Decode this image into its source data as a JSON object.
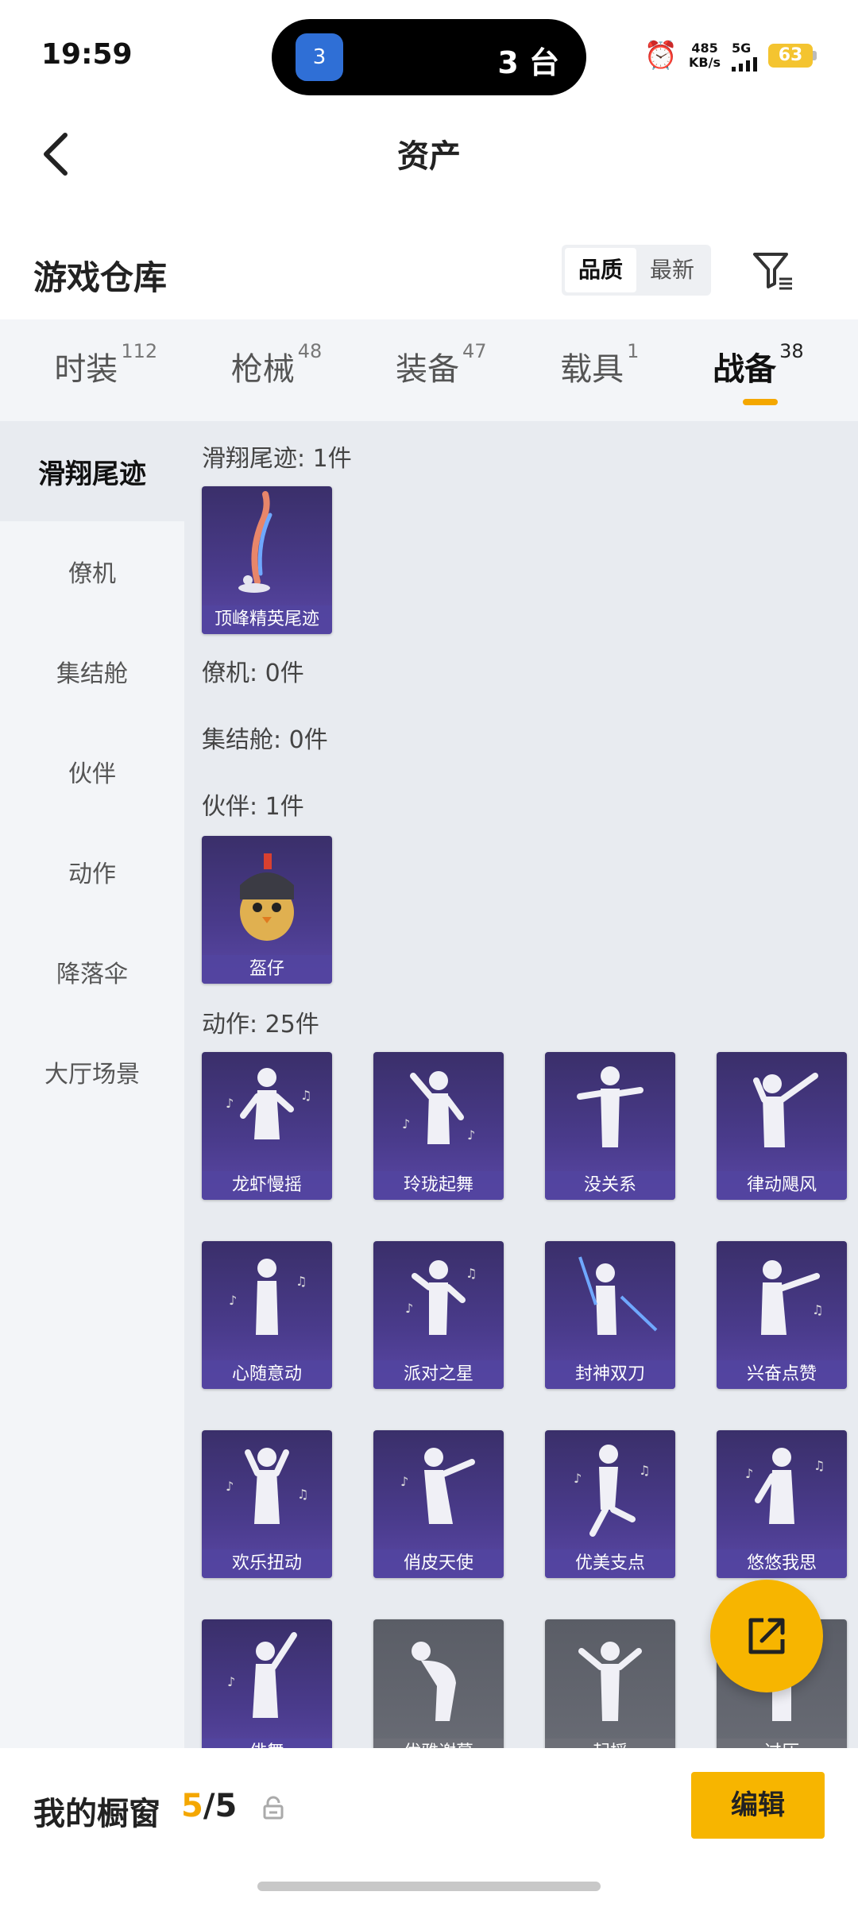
{
  "status": {
    "time": "19:59",
    "island_badge": "3",
    "island_count": "3 台",
    "net_speed_value": "485",
    "net_speed_unit": "KB/s",
    "network": "5G",
    "battery": "63"
  },
  "header": {
    "title": "资产"
  },
  "section": {
    "title": "游戏仓库",
    "sort_options": [
      "品质",
      "最新"
    ],
    "active_sort": "品质"
  },
  "tabs": [
    {
      "label": "时装",
      "count": "112"
    },
    {
      "label": "枪械",
      "count": "48"
    },
    {
      "label": "装备",
      "count": "47"
    },
    {
      "label": "载具",
      "count": "1"
    },
    {
      "label": "战备",
      "count": "38",
      "active": true
    }
  ],
  "sidebar": {
    "items": [
      "滑翔尾迹",
      "僚机",
      "集结舱",
      "伙伴",
      "动作",
      "降落伞",
      "大厅场景"
    ],
    "active": "滑翔尾迹"
  },
  "groups": {
    "glide_trail": {
      "title": "滑翔尾迹: 1件",
      "items": [
        "顶峰精英尾迹"
      ]
    },
    "wingman": {
      "title": "僚机: 0件"
    },
    "capsule": {
      "title": "集结舱: 0件"
    },
    "partner": {
      "title": "伙伴: 1件",
      "items": [
        "盔仔"
      ]
    },
    "emote": {
      "title": "动作: 25件",
      "items": [
        "龙虾慢摇",
        "玲珑起舞",
        "没关系",
        "律动飓风",
        "心随意动",
        "派对之星",
        "封神双刀",
        "兴奋点赞",
        "欢乐扭动",
        "俏皮天使",
        "优美支点",
        "悠悠我思",
        "俳舞",
        "优雅谢幕",
        "起摇",
        "过压"
      ]
    }
  },
  "bottom": {
    "showcase_label": "我的橱窗",
    "showcase_used": "5",
    "showcase_total": "/5",
    "edit_label": "编辑"
  },
  "colors": {
    "accent": "#f7b500",
    "card": "#4a3b8c"
  }
}
